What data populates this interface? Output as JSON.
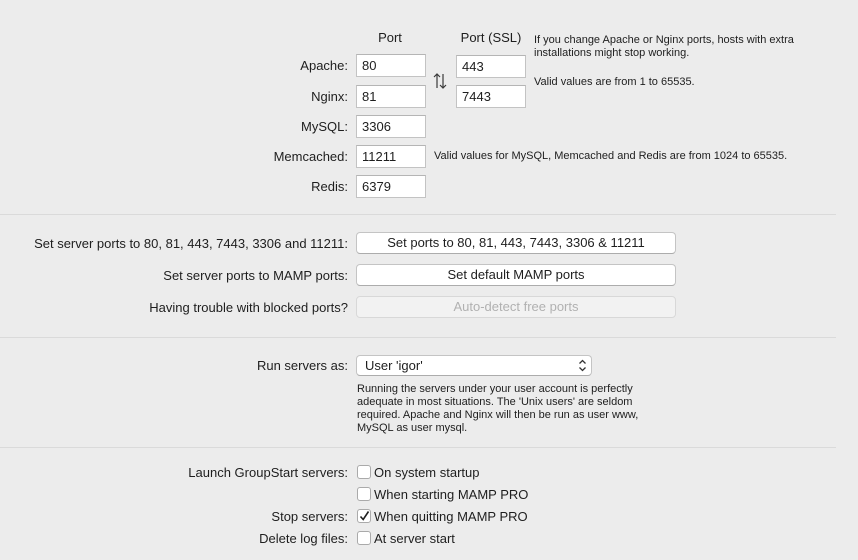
{
  "ports": {
    "col_port": "Port",
    "col_ssl": "Port (SSL)",
    "apache": {
      "label": "Apache:",
      "port": "80",
      "ssl": "443"
    },
    "nginx": {
      "label": "Nginx:",
      "port": "81",
      "ssl": "7443"
    },
    "mysql": {
      "label": "MySQL:",
      "port": "3306"
    },
    "memcached": {
      "label": "Memcached:",
      "port": "11211"
    },
    "redis": {
      "label": "Redis:",
      "port": "6379"
    },
    "note_change": "If you change Apache or Nginx ports, hosts with extra installations might stop working.",
    "note_valid_web": "Valid values are from 1 to 65535.",
    "note_valid_other": "Valid values for MySQL, Memcached and Redis are from 1024 to 65535.",
    "swap_icon": "swap-arrows-icon"
  },
  "actions": {
    "set_standard_label": "Set server ports to 80, 81, 443, 7443, 3306 and 11211:",
    "set_standard_button": "Set ports to 80, 81, 443, 7443, 3306 & 11211",
    "set_mamp_label": "Set server ports to MAMP ports:",
    "set_mamp_button": "Set default MAMP ports",
    "blocked_label": "Having trouble with blocked ports?",
    "autodetect_button": "Auto-detect free ports"
  },
  "run_as": {
    "label": "Run servers as:",
    "selected": "User 'igor'",
    "description": "Running the servers under your user account is perfectly adequate in most situations. The 'Unix users' are seldom required. Apache and Nginx will then be run as user www, MySQL as user mysql."
  },
  "startup": {
    "launch_label": "Launch GroupStart servers:",
    "on_system_startup": {
      "label": "On system startup",
      "checked": false
    },
    "when_starting": {
      "label": "When starting MAMP PRO",
      "checked": false
    },
    "stop_label": "Stop servers:",
    "when_quitting": {
      "label": "When quitting MAMP PRO",
      "checked": true
    },
    "delete_logs_label": "Delete log files:",
    "at_server_start": {
      "label": "At server start",
      "checked": false
    }
  }
}
